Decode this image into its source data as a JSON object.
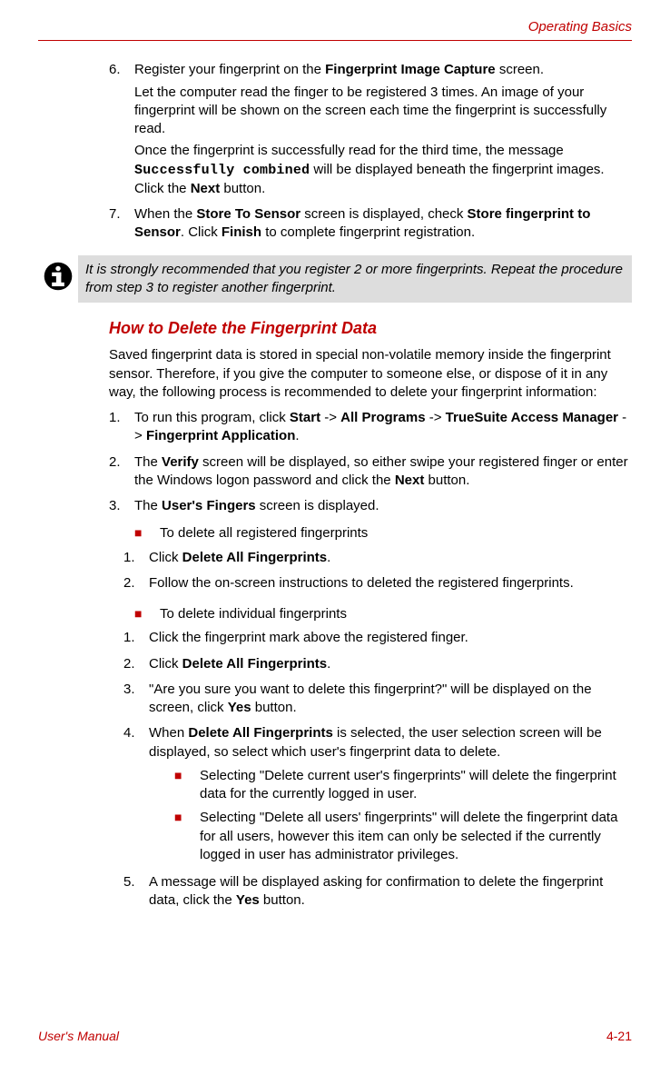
{
  "header": {
    "section": "Operating Basics"
  },
  "step6": {
    "num": "6.",
    "line1a": "Register your fingerprint on the ",
    "line1b": "Fingerprint Image Capture",
    "line1c": " screen.",
    "para2": "Let the computer read the finger to be registered 3 times. An image of your fingerprint will be shown on the screen each time the fingerprint is successfully read.",
    "para3a": "Once the fingerprint is successfully read for the third time, the message ",
    "para3b": "Successfully combined",
    "para3c": " will be displayed beneath the fingerprint images. Click the ",
    "para3d": "Next",
    "para3e": " button."
  },
  "step7": {
    "num": "7.",
    "a": "When the ",
    "b": "Store To Sensor",
    "c": " screen is displayed, check ",
    "d": "Store fingerprint to Sensor",
    "e": ". Click ",
    "f": "Finish",
    "g": " to complete fingerprint registration."
  },
  "note": {
    "text": "It is strongly recommended that you register 2 or more fingerprints. Repeat the procedure from step 3 to register another fingerprint."
  },
  "heading": "How to Delete the Fingerprint Data",
  "intro": "Saved fingerprint data is stored in special non-volatile memory inside the fingerprint sensor. Therefore, if you give the computer to someone else, or dispose of it in any way, the following process is recommended to delete your fingerprint information:",
  "d1": {
    "num": "1.",
    "a": "To run this program, click ",
    "b": "Start",
    "c": " -> ",
    "d": "All Programs",
    "e": " -> ",
    "f": "TrueSuite Access Manager",
    "g": " -> ",
    "h": "Fingerprint Application",
    "i": "."
  },
  "d2": {
    "num": "2.",
    "a": "The ",
    "b": "Verify",
    "c": " screen will be displayed, so either swipe your registered finger or enter the Windows logon password and click the ",
    "d": "Next",
    "e": " button."
  },
  "d3": {
    "num": "3.",
    "a": "The ",
    "b": "User's Fingers",
    "c": " screen is displayed."
  },
  "bulletA": {
    "label": "To delete all registered fingerprints",
    "s1": {
      "num": "1.",
      "a": "Click ",
      "b": "Delete All Fingerprints",
      "c": "."
    },
    "s2": {
      "num": "2.",
      "text": "Follow the on-screen instructions to deleted the registered fingerprints."
    }
  },
  "bulletB": {
    "label": "To delete individual fingerprints",
    "s1": {
      "num": "1.",
      "text": "Click the fingerprint mark above the registered finger."
    },
    "s2": {
      "num": "2.",
      "a": "Click ",
      "b": "Delete All Fingerprints",
      "c": "."
    },
    "s3": {
      "num": "3.",
      "a": "\"Are you sure you want to delete this fingerprint?\" will be displayed on the screen, click ",
      "b": "Yes",
      "c": " button."
    },
    "s4": {
      "num": "4.",
      "a": "When ",
      "b": "Delete All Fingerprints",
      "c": " is selected, the user selection screen will be displayed, so select which user's fingerprint data to delete.",
      "sub1": "Selecting \"Delete current user's fingerprints\" will delete the fingerprint data for the currently logged in user.",
      "sub2": "Selecting \"Delete all users' fingerprints\" will delete the fingerprint data for all users, however this item can only be selected if the currently logged in user has administrator privileges."
    },
    "s5": {
      "num": "5.",
      "a": "A message will be displayed asking for confirmation to delete the fingerprint data, click the ",
      "b": "Yes",
      "c": " button."
    }
  },
  "footer": {
    "left": "User's Manual",
    "right": "4-21"
  },
  "bullet_mark": "■"
}
